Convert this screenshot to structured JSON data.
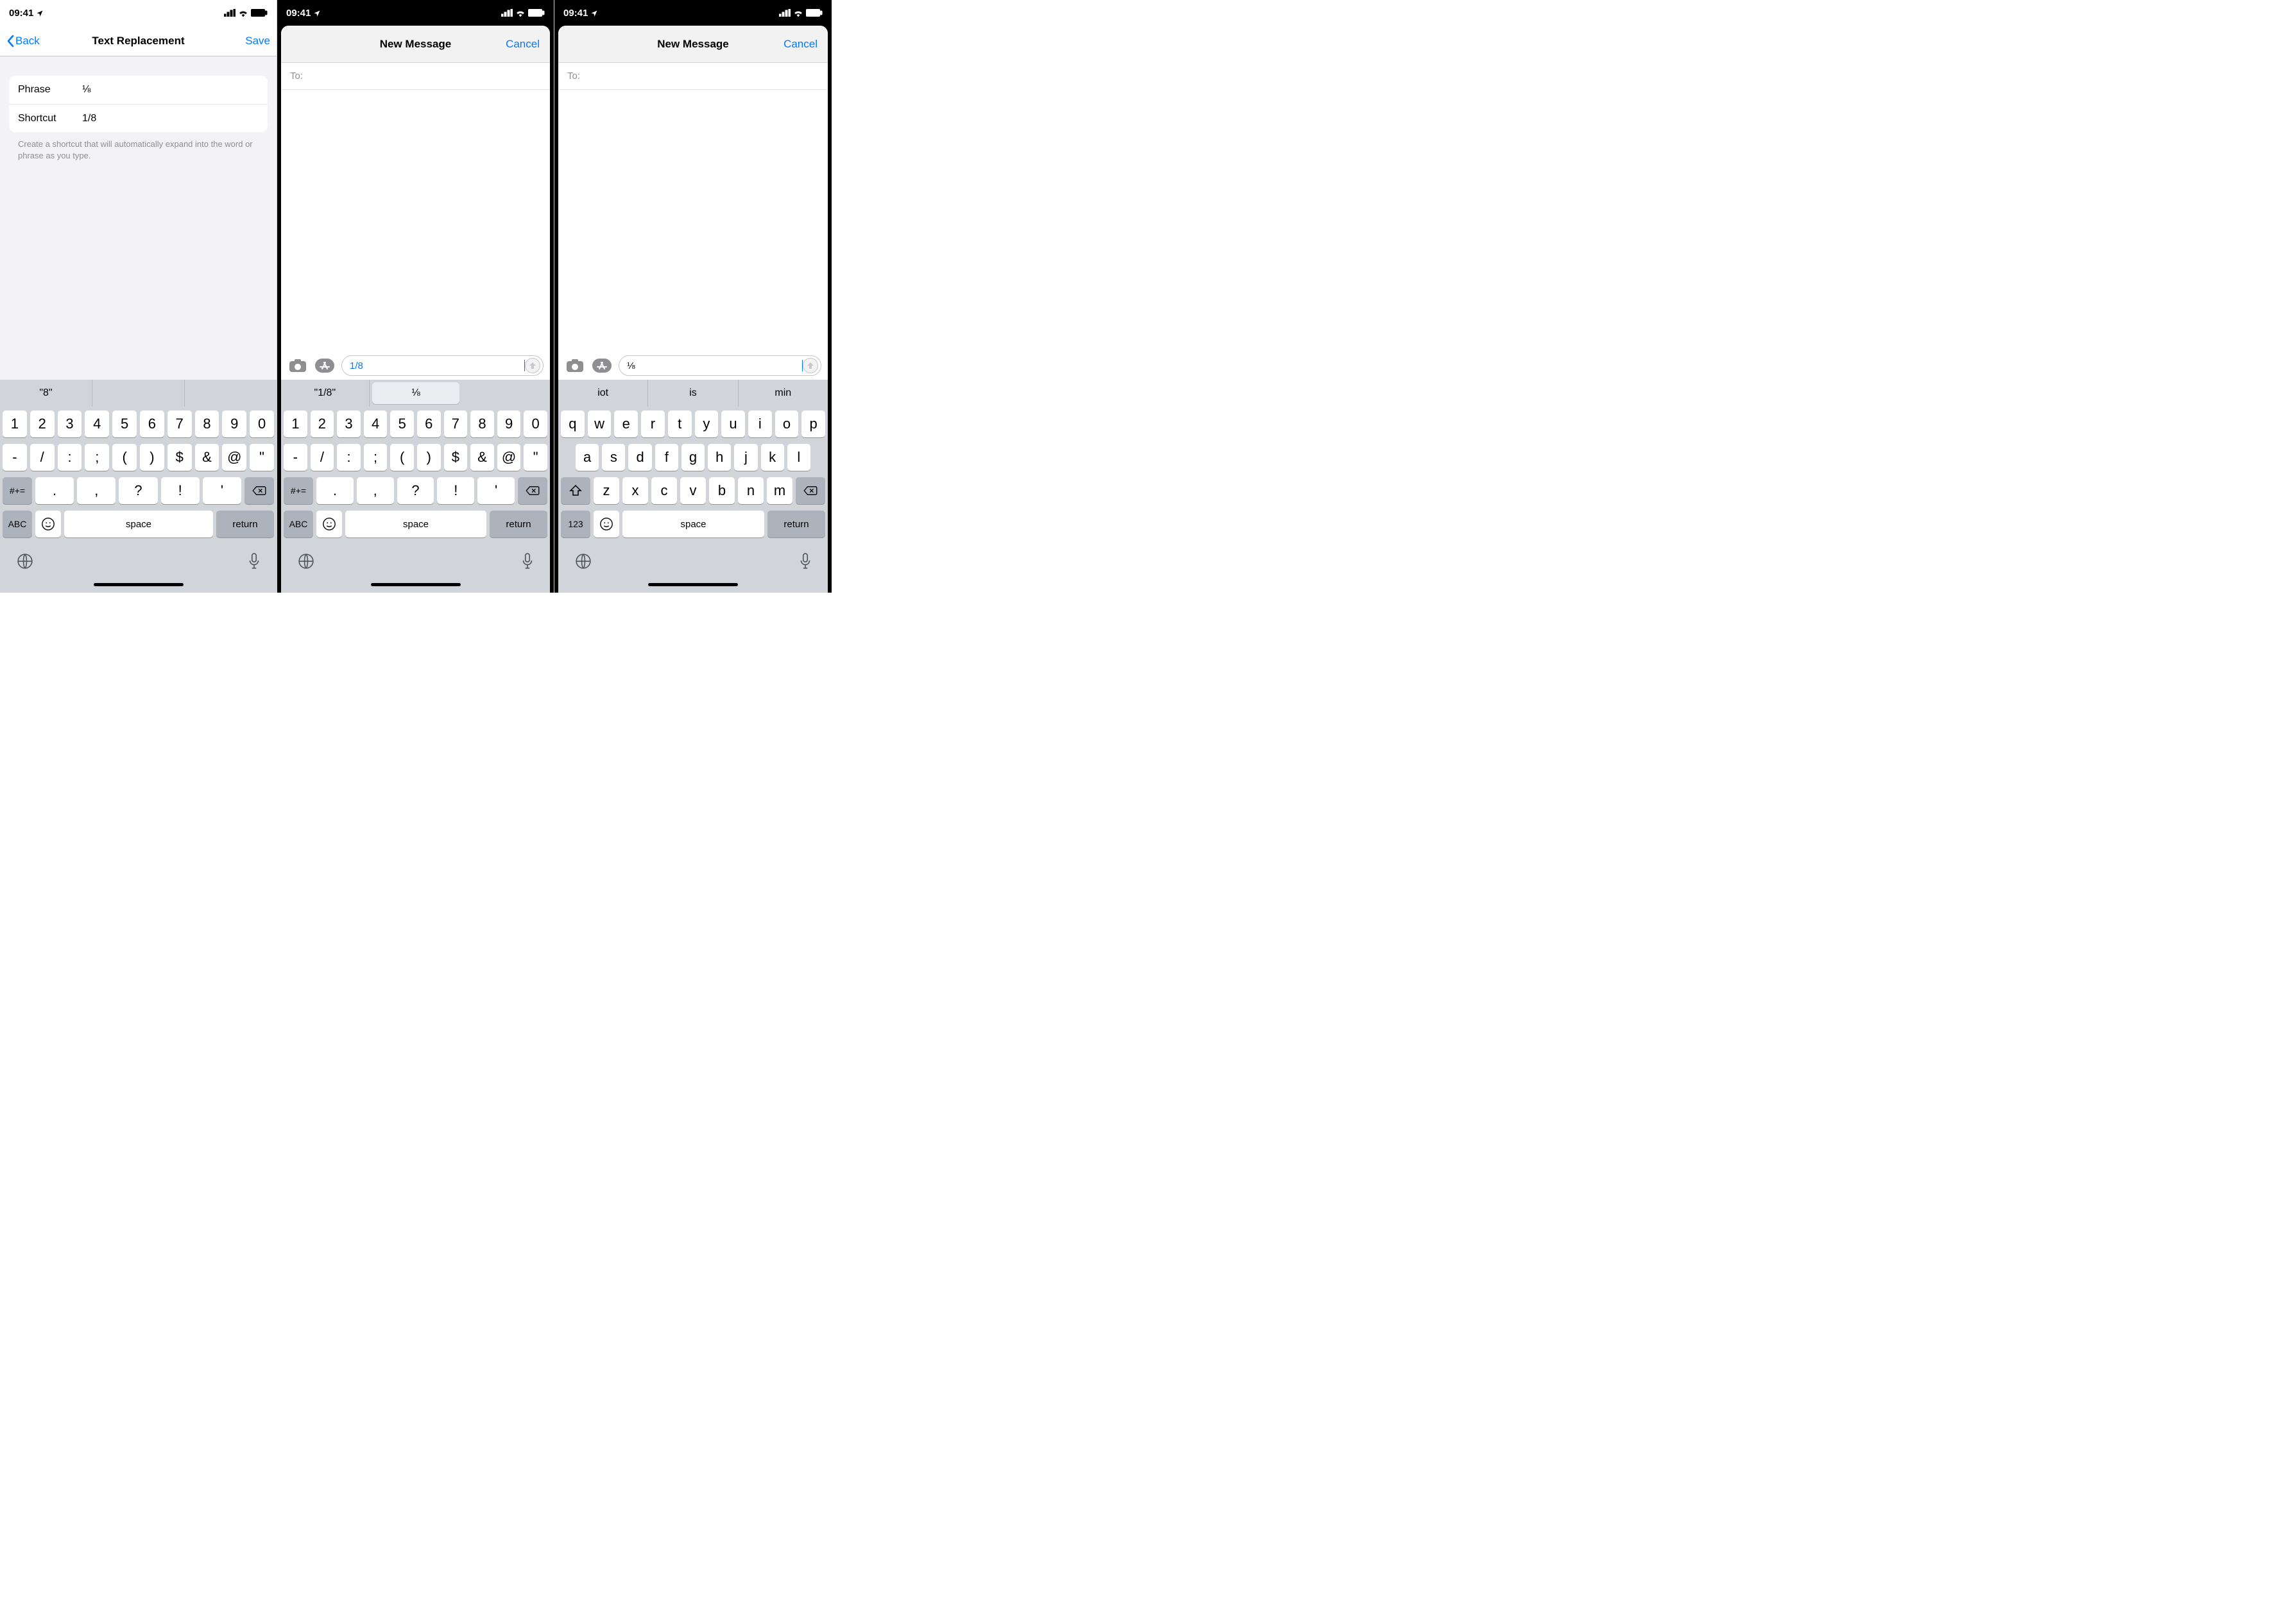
{
  "status": {
    "time": "09:41",
    "signal": "••••",
    "wifi": "wifi",
    "battery": "batt"
  },
  "screen1": {
    "back": "Back",
    "title": "Text Replacement",
    "save": "Save",
    "phrase_label": "Phrase",
    "phrase_value": "⅛",
    "shortcut_label": "Shortcut",
    "shortcut_value": "1/8",
    "footer": "Create a shortcut that will automatically expand into the word or phrase as you type."
  },
  "compose": {
    "title": "New Message",
    "cancel": "Cancel",
    "to": "To:"
  },
  "input2": "1/8",
  "input3": "⅛ ",
  "preds1": [
    "\"8\"",
    "",
    ""
  ],
  "preds2": [
    "\"1/8\"",
    "⅛"
  ],
  "preds3": [
    "iot",
    "is",
    "min"
  ],
  "kb_sym": {
    "r1": [
      "1",
      "2",
      "3",
      "4",
      "5",
      "6",
      "7",
      "8",
      "9",
      "0"
    ],
    "r2": [
      "-",
      "/",
      ":",
      ";",
      "(",
      ")",
      "$",
      "&",
      "@",
      "\""
    ],
    "r3_alt": "#+=",
    "r3": [
      ".",
      ",",
      "?",
      "!",
      "'"
    ],
    "abc": "ABC",
    "space": "space",
    "ret": "return"
  },
  "kb_alpha": {
    "r1": [
      "q",
      "w",
      "e",
      "r",
      "t",
      "y",
      "u",
      "i",
      "o",
      "p"
    ],
    "r2": [
      "a",
      "s",
      "d",
      "f",
      "g",
      "h",
      "j",
      "k",
      "l"
    ],
    "r3": [
      "z",
      "x",
      "c",
      "v",
      "b",
      "n",
      "m"
    ],
    "num": "123",
    "space": "space",
    "ret": "return"
  }
}
